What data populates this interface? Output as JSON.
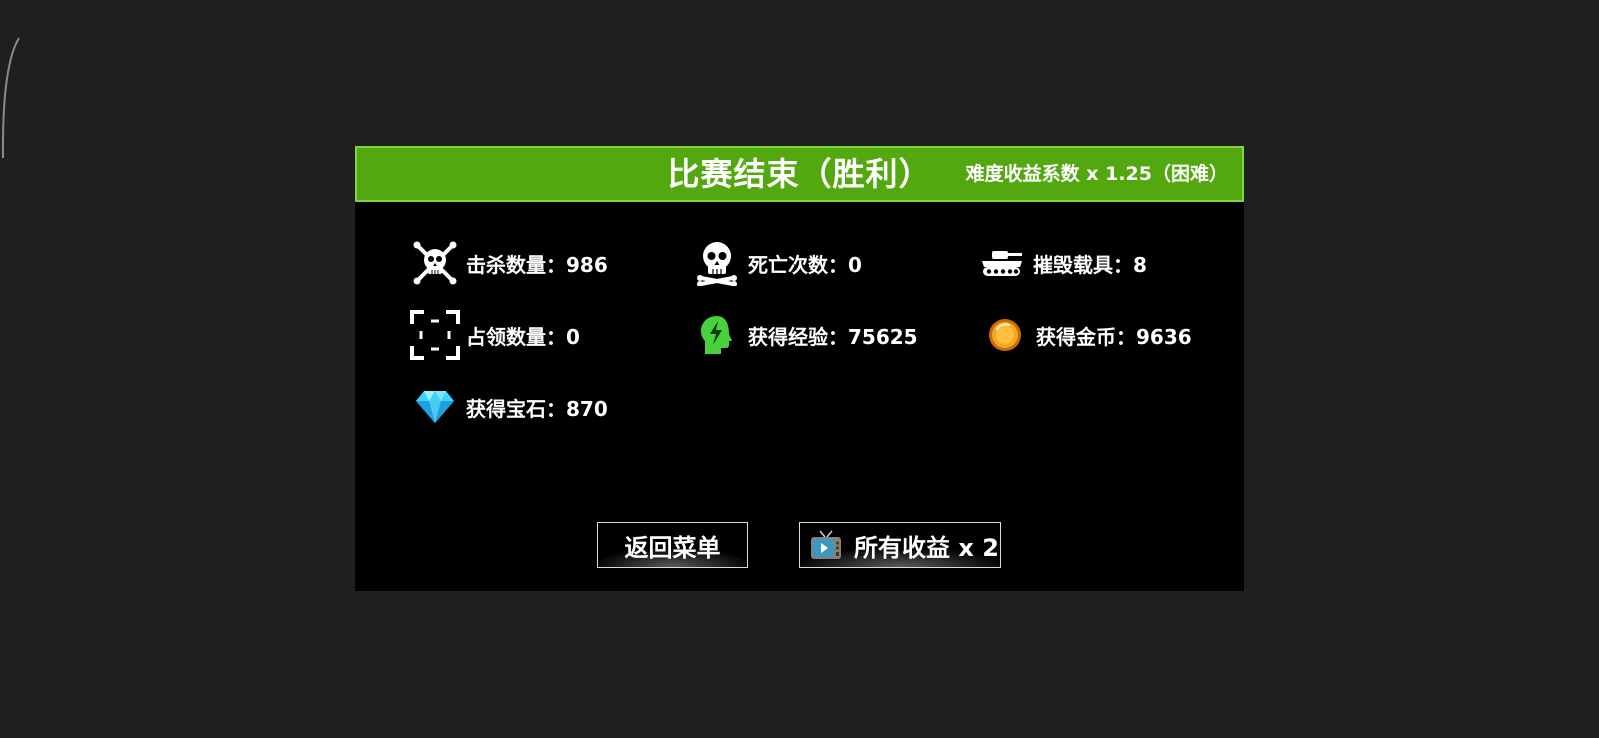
{
  "colors": {
    "background": "#1f1f1f",
    "panel": "#000000",
    "header": "#53a80f",
    "header_border": "#7fd63a",
    "text": "#ffffff",
    "exp_icon": "#49d13d",
    "coin": "#f5a623",
    "gem": "#3fd3ff"
  },
  "header": {
    "title": "比赛结束（胜利）",
    "multiplier": "难度收益系数 x 1.25（困难）"
  },
  "stats": {
    "kills": {
      "label": "击杀数量：986",
      "icon": "skull-crossbones-icon"
    },
    "deaths": {
      "label": "死亡次数：0",
      "icon": "skull-icon"
    },
    "vehicles": {
      "label": "摧毁载具：8",
      "icon": "tank-icon"
    },
    "captures": {
      "label": "占领数量：0",
      "icon": "capture-frame-icon"
    },
    "experience": {
      "label": "获得经验：75625",
      "icon": "brain-lightning-icon"
    },
    "coins": {
      "label": "获得金币：9636",
      "icon": "gold-coin-icon"
    },
    "gems": {
      "label": "获得宝石：870",
      "icon": "diamond-icon"
    }
  },
  "buttons": {
    "menu_label": "返回菜单",
    "double_label": "所有收益 x 2",
    "double_icon": "tv-ad-icon"
  }
}
